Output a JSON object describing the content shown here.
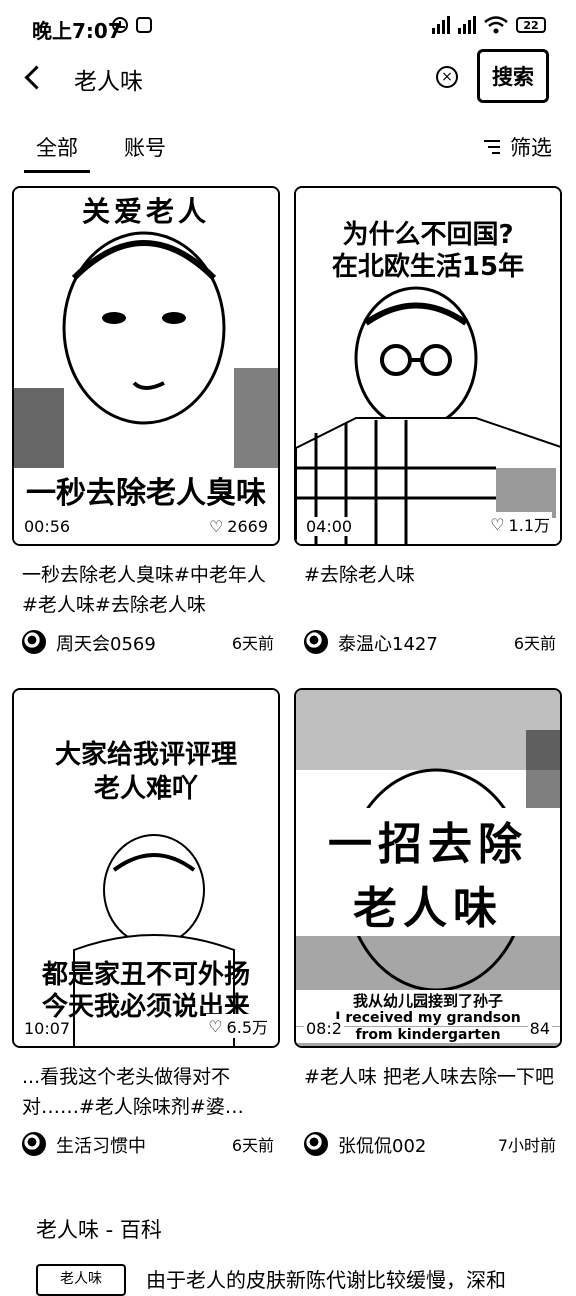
{
  "status_bar": {
    "time": "晚上7:07",
    "battery": "22"
  },
  "search": {
    "query": "老人味",
    "button_label": "搜索"
  },
  "tabs": {
    "all": "全部",
    "accounts": "账号",
    "filter": "筛选"
  },
  "results": [
    {
      "overlay_top": "关爱老人",
      "overlay_caption": "一秒去除老人臭味",
      "duration": "00:56",
      "likes": "2669",
      "title": "一秒去除老人臭味#中老年人#老人味#去除老人味",
      "author": "周天会0569",
      "ago": "6天前"
    },
    {
      "overlay_top": "为什么不回国?",
      "overlay_top2": "在北欧生活15年",
      "duration": "04:00",
      "likes": "1.1万",
      "title": "#去除老人味",
      "author": "泰温心1427",
      "ago": "6天前"
    },
    {
      "overlay_top": "大家给我评评理",
      "overlay_top2": "老人难吖",
      "overlay_bottom": "都是家丑不可外扬",
      "overlay_bottom2": "今天我必须说出来",
      "duration": "10:07",
      "likes": "6.5万",
      "title": "...看我这个老头做得对不对……#老人除味剂#婆…",
      "author": "生活习惯中",
      "ago": "6天前"
    },
    {
      "overlay_top": "一招去除",
      "overlay_top2": "老人味",
      "overlay_sub1": "我从幼儿园接到了孙子",
      "overlay_sub2": "I received my grandson",
      "overlay_sub3": "from kindergarten",
      "duration": "08:2",
      "likes": "84",
      "title": "#老人味 把老人味去除一下吧",
      "author": "张侃侃002",
      "ago": "7小时前"
    }
  ],
  "wiki": {
    "title": "老人味 - 百科",
    "badge": "老人味",
    "snippet": "由于老人的皮肤新陈代谢比较缓慢，深和"
  }
}
